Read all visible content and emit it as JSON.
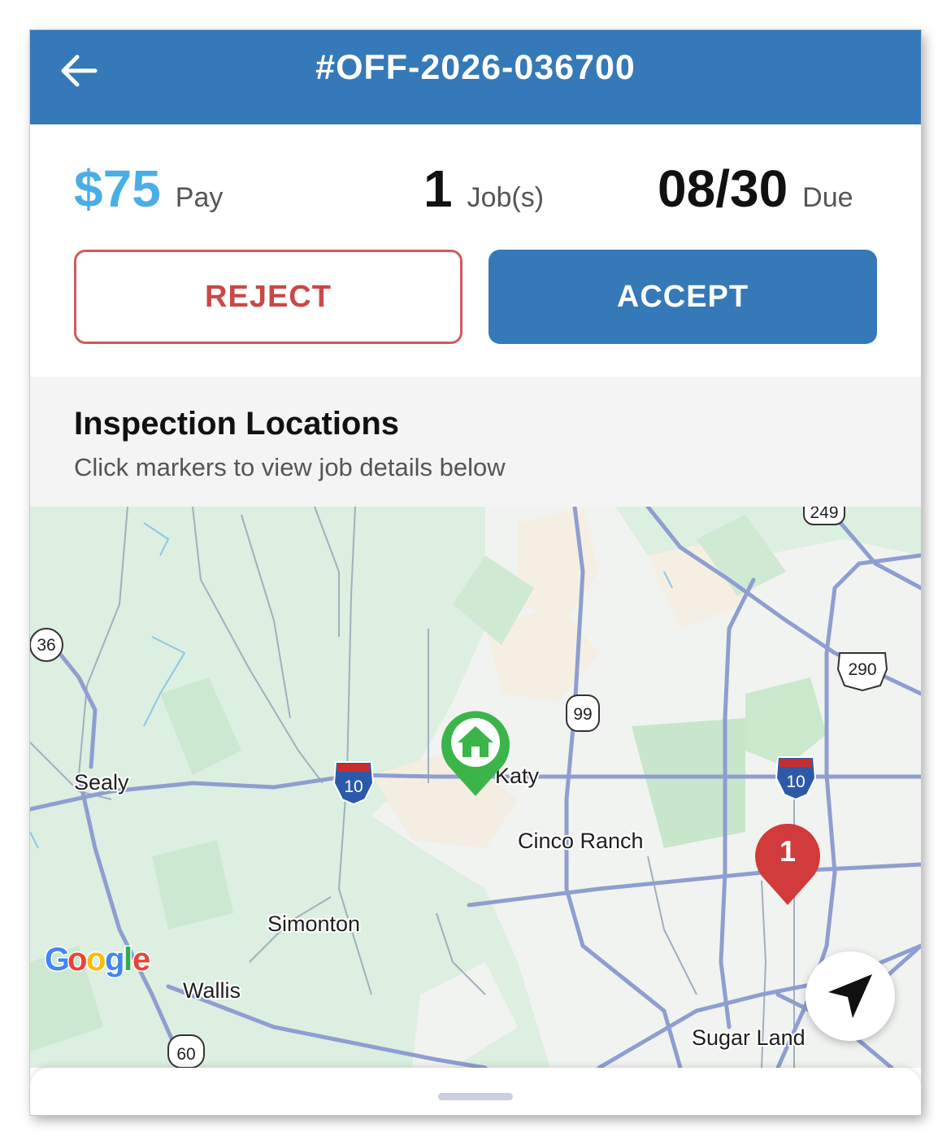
{
  "header": {
    "title": "#OFF-2026-036700",
    "back_icon": "arrow-left-icon"
  },
  "summary": {
    "pay_value": "$75",
    "pay_label": "Pay",
    "jobs_value": "1",
    "jobs_label": "Job(s)",
    "due_value": "08/30",
    "due_label": "Due"
  },
  "actions": {
    "reject_label": "REJECT",
    "accept_label": "ACCEPT"
  },
  "locations": {
    "title": "Inspection Locations",
    "subtitle": "Click markers to view job details below"
  },
  "map": {
    "attribution": "Google",
    "cities": [
      "Sealy",
      "Katy",
      "Cinco Ranch",
      "Simonton",
      "Wallis",
      "Sugar Land"
    ],
    "shields": [
      "249",
      "36",
      "290",
      "99",
      "10",
      "10",
      "60"
    ],
    "markers": [
      {
        "type": "home",
        "icon": "home-icon",
        "color": "#3bb54a"
      },
      {
        "type": "job",
        "label": "1",
        "color": "#d23b3b"
      }
    ],
    "recenter_icon": "navigation-arrow-icon"
  },
  "colors": {
    "primary": "#3579b8",
    "pay": "#4aaee6",
    "reject": "#c94848"
  }
}
